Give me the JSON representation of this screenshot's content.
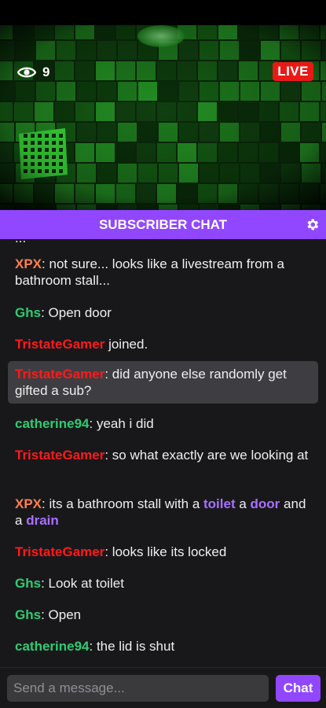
{
  "stream": {
    "viewer_count": "9",
    "live_label": "LIVE"
  },
  "chat": {
    "header_title": "SUBSCRIBER CHAT",
    "partial_line_text": "...",
    "messages": [
      {
        "user": "XPX",
        "user_color": "#ff7f50",
        "sep": ": ",
        "parts": [
          {
            "t": "not sure... looks like a livestream from a bathroom stall..."
          }
        ]
      },
      {
        "user": "Ghs",
        "user_color": "#2ecc71",
        "sep": ": ",
        "parts": [
          {
            "t": "Open door"
          }
        ]
      },
      {
        "user": "TristateGamer",
        "user_color": "#ff1a1a",
        "sep": " ",
        "parts": [
          {
            "t": "joined."
          }
        ]
      },
      {
        "user": "TristateGamer",
        "user_color": "#ff1a1a",
        "sep": ": ",
        "highlight": true,
        "parts": [
          {
            "t": "did anyone else randomly get gifted a sub?"
          }
        ]
      },
      {
        "user": "catherine94",
        "user_color": "#2ecc71",
        "sep": ": ",
        "parts": [
          {
            "t": "yeah i did"
          }
        ]
      },
      {
        "user": "TristateGamer",
        "user_color": "#ff1a1a",
        "sep": ": ",
        "parts": [
          {
            "t": "so what exactly are we looking at"
          }
        ]
      },
      {
        "user": "XPX",
        "user_color": "#ff7f50",
        "sep": ": ",
        "parts": [
          {
            "t": "its a bathroom stall with a "
          },
          {
            "t": "toilet",
            "kw": true
          },
          {
            "t": " a "
          },
          {
            "t": "door",
            "kw": true
          },
          {
            "t": " and a "
          },
          {
            "t": "drain",
            "kw": true
          }
        ]
      },
      {
        "user": "TristateGamer",
        "user_color": "#ff1a1a",
        "sep": ": ",
        "parts": [
          {
            "t": "looks like its locked"
          }
        ]
      },
      {
        "user": "Ghs",
        "user_color": "#2ecc71",
        "sep": ": ",
        "parts": [
          {
            "t": "Look at toilet"
          }
        ]
      },
      {
        "user": "Ghs",
        "user_color": "#2ecc71",
        "sep": ": ",
        "parts": [
          {
            "t": "Open"
          }
        ]
      },
      {
        "user": "catherine94",
        "user_color": "#2ecc71",
        "sep": ": ",
        "parts": [
          {
            "t": "the lid is shut"
          }
        ]
      }
    ]
  },
  "composer": {
    "placeholder": "Send a message...",
    "send_label": "Chat"
  },
  "colors": {
    "accent": "#9147ff",
    "live": "#e91916",
    "keyword": "#a970ff"
  },
  "icons": {
    "viewers": "eye-icon",
    "settings": "gear-icon"
  }
}
